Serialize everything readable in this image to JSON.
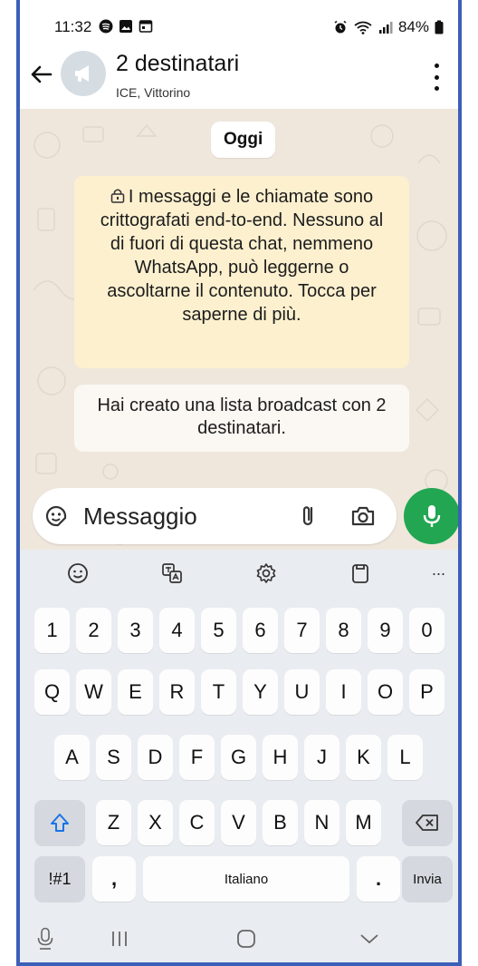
{
  "status_bar": {
    "time": "11:32",
    "battery": "84%"
  },
  "header": {
    "title": "2 destinatari",
    "subtitle": "ICE, Vittorino"
  },
  "chat": {
    "date_label": "Oggi",
    "encryption_notice": "I messaggi e le chiamate sono crittografati end-to-end. Nessuno al di fuori di questa chat, nemmeno WhatsApp, può leggerne o ascoltarne il contenuto. Tocca per saperne di più.",
    "system_message": "Hai creato una lista broadcast con 2 destinatari."
  },
  "composer": {
    "placeholder": "Messaggio"
  },
  "keyboard": {
    "toolbar_more": "···",
    "row_numbers": [
      "1",
      "2",
      "3",
      "4",
      "5",
      "6",
      "7",
      "8",
      "9",
      "0"
    ],
    "row_1": [
      "Q",
      "W",
      "E",
      "R",
      "T",
      "Y",
      "U",
      "I",
      "O",
      "P"
    ],
    "row_2": [
      "A",
      "S",
      "D",
      "F",
      "G",
      "H",
      "J",
      "K",
      "L"
    ],
    "row_3": [
      "Z",
      "X",
      "C",
      "V",
      "B",
      "N",
      "M"
    ],
    "symbols_key": "!#1",
    "comma_key": ",",
    "space_label": "Italiano",
    "period_key": ".",
    "send_key": "Invia"
  },
  "colors": {
    "accent_green": "#22a652",
    "chat_background": "#efe7dc",
    "notice_background": "#fdf0cf",
    "frame_border": "#3c5fb8"
  }
}
